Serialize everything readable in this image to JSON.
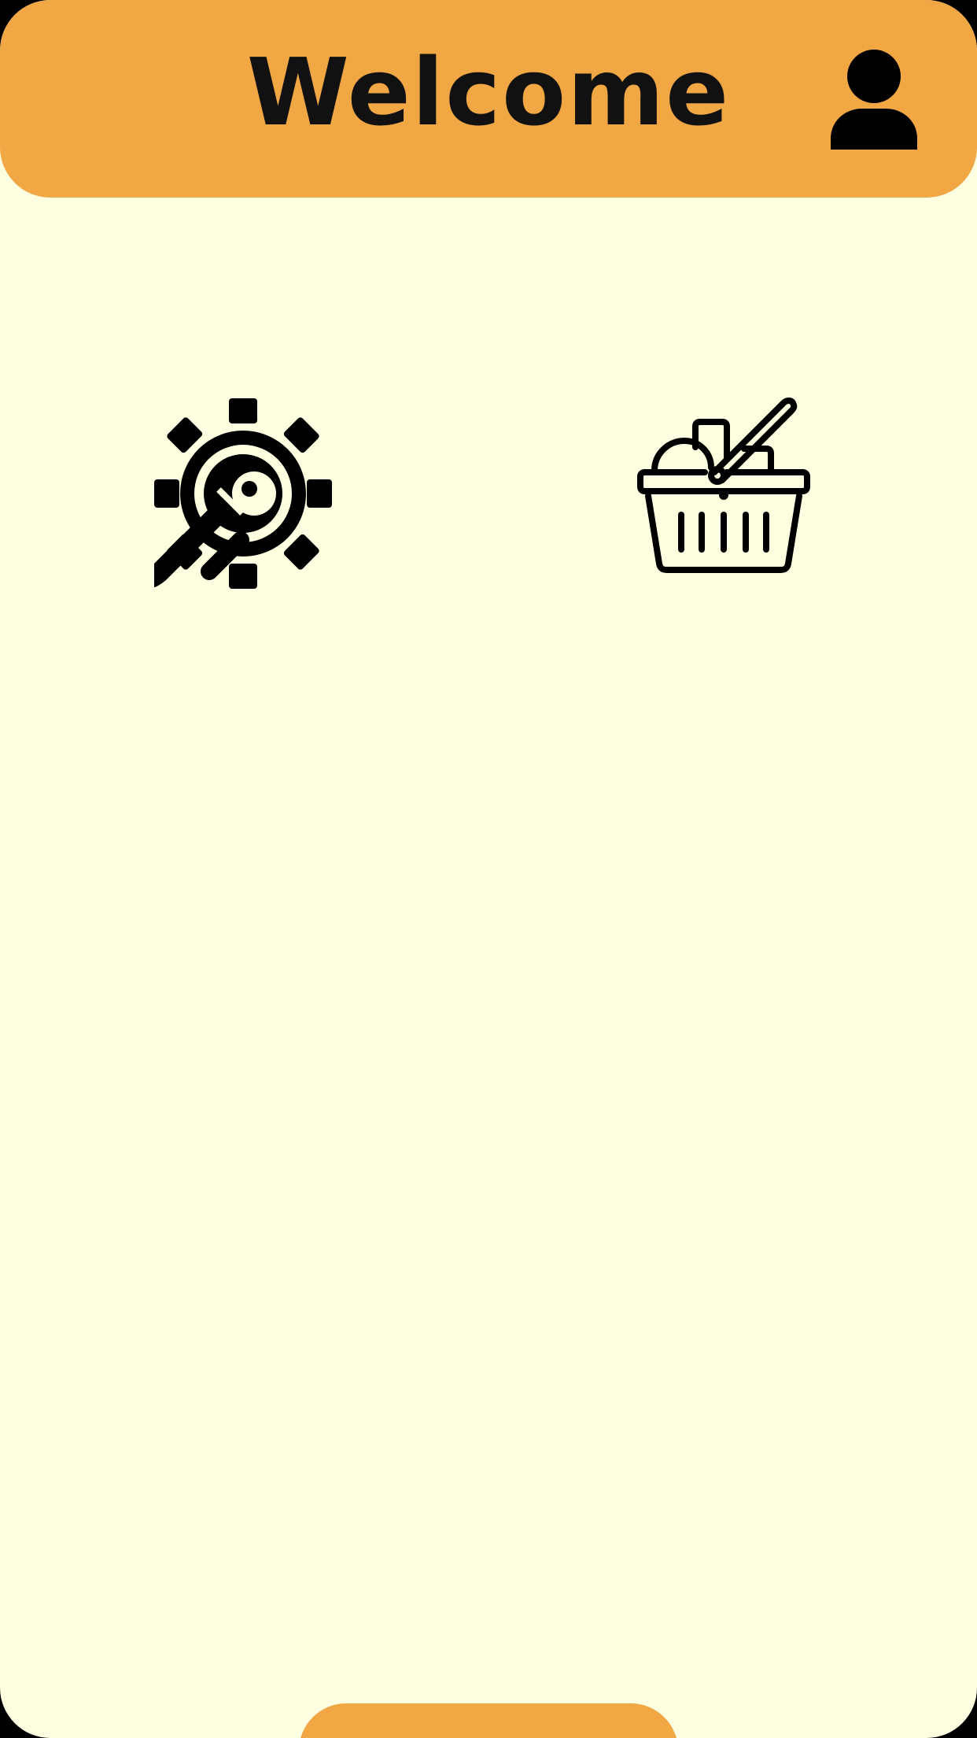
{
  "header": {
    "title": "Welcome",
    "profile_icon": "user-icon"
  },
  "tiles": [
    {
      "icon": "settings-wrench-gear-icon"
    },
    {
      "icon": "shopping-basket-icon"
    }
  ],
  "bottom_tab": {
    "icon": "none"
  },
  "colors": {
    "background": "#FEFEE0",
    "accent": "#F0A744",
    "icon": "#000000"
  }
}
